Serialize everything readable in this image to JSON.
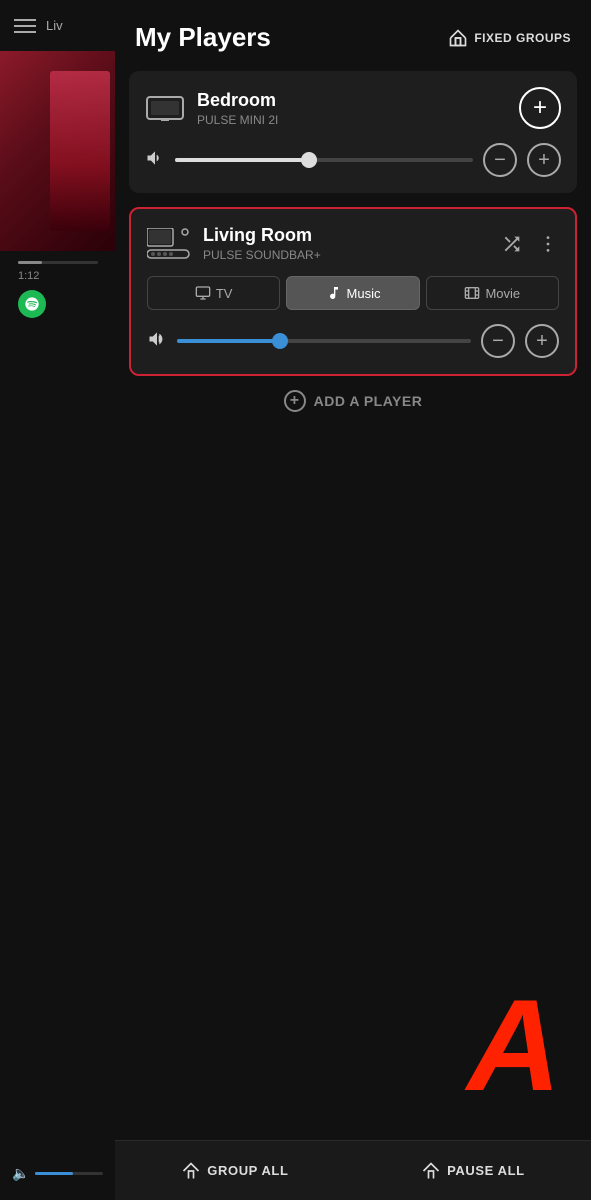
{
  "sidebar": {
    "menu_label": "Liv",
    "time": "1:12",
    "progress_percent": 30
  },
  "header": {
    "title": "My Players",
    "fixed_groups_label": "FIXED GROUPS"
  },
  "players": [
    {
      "id": "bedroom",
      "name": "Bedroom",
      "model": "PULSE MINI 2I",
      "highlighted": false,
      "volume": 45,
      "has_modes": false
    },
    {
      "id": "living_room",
      "name": "Living Room",
      "model": "PULSE SOUNDBAR+",
      "highlighted": true,
      "volume": 35,
      "has_modes": true,
      "modes": [
        "TV",
        "Music",
        "Movie"
      ],
      "active_mode": "Music"
    }
  ],
  "add_player_label": "ADD A PLAYER",
  "watermark": "A",
  "bottom_bar": {
    "group_all_label": "GROUP ALL",
    "pause_all_label": "PAUSE ALL"
  }
}
